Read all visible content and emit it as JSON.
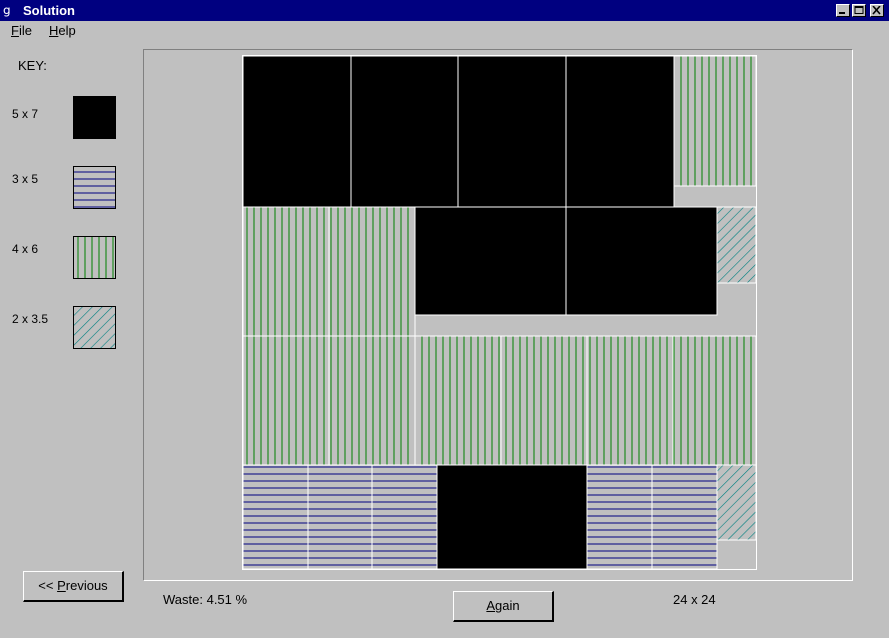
{
  "window": {
    "title": "Solution",
    "icon": "app-icon",
    "controls": [
      "minimize-icon",
      "maximize-icon",
      "close-icon"
    ]
  },
  "menu": {
    "file": {
      "label": "File",
      "accel": "F",
      "rest": "ile"
    },
    "help": {
      "label": "Help",
      "accel": "H",
      "rest": "elp"
    }
  },
  "key": {
    "heading": "KEY:",
    "items": [
      {
        "label": "5 x 7",
        "pattern": "solid-black"
      },
      {
        "label": "3 x 5",
        "pattern": "horizontal-navy-lines"
      },
      {
        "label": "4 x 6",
        "pattern": "vertical-green-lines"
      },
      {
        "label": "2 x 3.5",
        "pattern": "diagonal-teal-lines"
      }
    ]
  },
  "layout_pieces": {
    "row1": [
      "5 x 7",
      "5 x 7",
      "5 x 7",
      "5 x 7",
      "4 x 6"
    ],
    "row2": [
      "4 x 6",
      "4 x 6",
      "5 x 7",
      "5 x 7",
      "2 x 3.5"
    ],
    "row3": [
      "4 x 6",
      "4 x 6",
      "4 x 6",
      "4 x 6",
      "4 x 6",
      "4 x 6"
    ],
    "row4": [
      "3 x 5",
      "3 x 5",
      "3 x 5",
      "5 x 7",
      "3 x 5",
      "3 x 5",
      "2 x 3.5"
    ]
  },
  "buttons": {
    "previous": {
      "prefix": "<< ",
      "accel": "P",
      "rest": "revious"
    },
    "again": {
      "accel": "A",
      "rest": "gain"
    }
  },
  "status": {
    "waste": "Waste: 4.51 %",
    "sheet_size": "24 x 24"
  },
  "colors": {
    "face": "#c0c0c0",
    "titlebar": "#000080",
    "pattern_5x7": "#000000",
    "pattern_3x5": "#000080",
    "pattern_4x6": "#008000",
    "pattern_2x35": "#008080"
  }
}
